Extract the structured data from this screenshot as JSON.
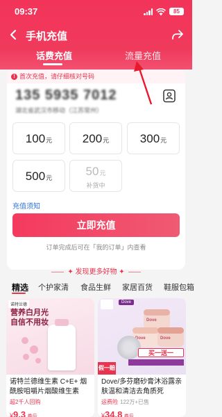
{
  "status_bar": {
    "time": "09:37",
    "battery": "85"
  },
  "nav": {
    "title": "手机充值"
  },
  "tabs": [
    {
      "label": "话费充值"
    },
    {
      "label": "流量充值"
    }
  ],
  "notice": {
    "text": "首次充值，请仔细核对号码"
  },
  "phone": {
    "number": "135 5935 7012",
    "carrier": "湖北省武汉市移动（江苏常州）"
  },
  "amounts": [
    {
      "value": "100",
      "unit": "元"
    },
    {
      "value": "200",
      "unit": "元"
    },
    {
      "value": "300",
      "unit": "元"
    },
    {
      "value": "500",
      "unit": "元"
    },
    {
      "value": "50",
      "unit": "元",
      "status": "补货中"
    }
  ],
  "recharge_notes_link": "充值须知",
  "recharge_button": "立即充值",
  "order_tip": "订单完成后可在「我的订单」内查看",
  "discover": "发现更多好物",
  "categories": [
    "精选",
    "个护家清",
    "食品生鲜",
    "家居百货",
    "鞋服包箱"
  ],
  "products": [
    {
      "brand": "诺特兰德",
      "promo": "营养白月光\n自信不用妆",
      "title": "诺特兰德维生素 C+E+ 烟酰胺咀嚼片烟酸维生素",
      "tag": "超2千人回购",
      "price_symbol": "¥",
      "price": "9.3",
      "price_note": "券后"
    },
    {
      "brand": "Dove",
      "promo": "买一送一",
      "side_tag": "假一赔十",
      "title": "Dove/多芬磨砂膏沐浴露亲肤温和清洁去角质死",
      "tag": "运费险",
      "tag2": "122万+已售",
      "price_symbol": "¥",
      "price": "34.8",
      "price_note": "券后"
    }
  ],
  "colors": {
    "accent": "#e8344f",
    "header": "#f3345a",
    "link": "#2f73d9"
  }
}
